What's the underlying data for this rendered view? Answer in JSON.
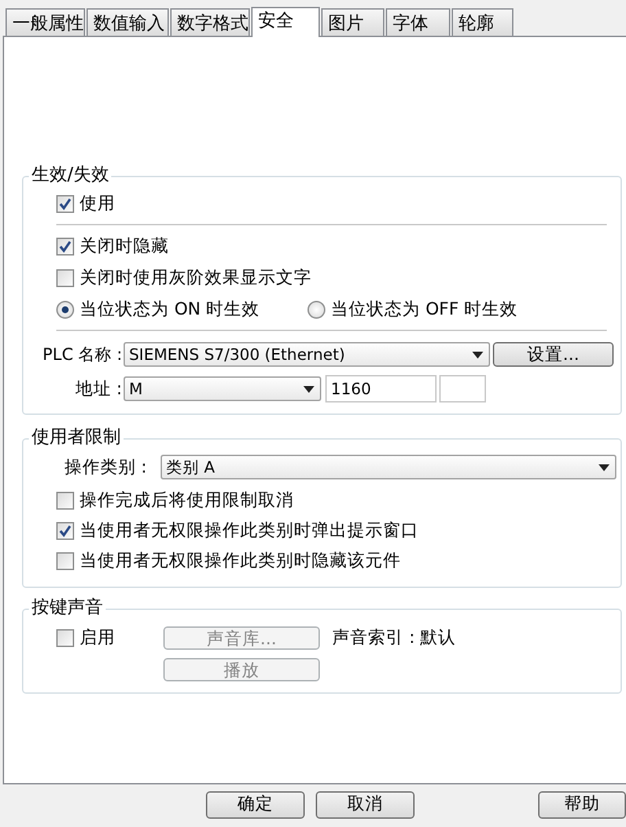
{
  "tabs": [
    {
      "label": "一般属性",
      "selected": false
    },
    {
      "label": "数值输入",
      "selected": false
    },
    {
      "label": "数字格式",
      "selected": false
    },
    {
      "label": "安全",
      "selected": true
    },
    {
      "label": "图片",
      "selected": false
    },
    {
      "label": "字体",
      "selected": false
    },
    {
      "label": "轮廓",
      "selected": false
    }
  ],
  "enable_group": {
    "title": "生效/失效",
    "use": {
      "label": "使用",
      "checked": true
    },
    "options": [
      {
        "label": "关闭时隐藏",
        "checked": true
      },
      {
        "label": "关闭时使用灰阶效果显示文字",
        "checked": false
      }
    ],
    "trigger": [
      {
        "label": "当位状态为 ON 时生效",
        "selected": true
      },
      {
        "label": "当位状态为 OFF 时生效",
        "selected": false
      }
    ],
    "plc": {
      "label": "PLC 名称 :",
      "value": "SIEMENS S7/300 (Ethernet)",
      "button": "设置..."
    },
    "address": {
      "label": "地址 :",
      "device": "M",
      "value": "1160"
    }
  },
  "user_group": {
    "title": "使用者限制",
    "category": {
      "label": "操作类别 :",
      "value": "类别 A"
    },
    "options": [
      {
        "label": "操作完成后将使用限制取消",
        "checked": false
      },
      {
        "label": "当使用者无权限操作此类别时弹出提示窗口",
        "checked": true
      },
      {
        "label": "当使用者无权限操作此类别时隐藏该元件",
        "checked": false
      }
    ]
  },
  "sound_group": {
    "title": "按键声音",
    "enable": {
      "label": "启用",
      "checked": false
    },
    "library_button": {
      "label": "声音库...",
      "disabled": true
    },
    "index": "声音索引 : 默认",
    "play_button": {
      "label": "播放",
      "disabled": true
    }
  },
  "buttons": [
    "确定",
    "取消",
    "帮助"
  ]
}
